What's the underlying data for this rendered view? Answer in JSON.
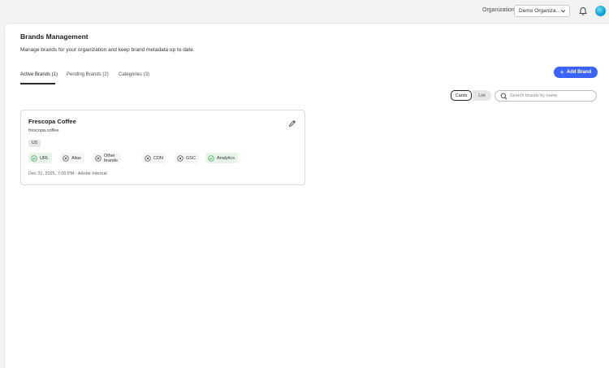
{
  "header": {
    "org_label": "Organization",
    "org_selected": "Demo Organiza...",
    "icons": {
      "bell": "bell-icon",
      "avatar": "user-avatar"
    }
  },
  "page": {
    "title": "Brands Management",
    "subtitle": "Manage brands for your organization and keep brand metadata up to date.",
    "add_button": "Add Brand"
  },
  "tabs": [
    {
      "label": "Active Brands (1)",
      "active": true
    },
    {
      "label": "Pending Brands (2)",
      "active": false
    },
    {
      "label": "Categories (3)",
      "active": false
    }
  ],
  "view_toggle": {
    "cards": "Cards",
    "list": "List",
    "selected": "Cards"
  },
  "search": {
    "placeholder": "Search brands by name",
    "value": ""
  },
  "brand_card": {
    "name": "Frescopa Coffee",
    "domain": "frescopa.coffee",
    "region": "US",
    "chips": [
      {
        "label": "URL",
        "status": "ok"
      },
      {
        "label": "Alias",
        "status": "missing"
      },
      {
        "label": "Other brands",
        "status": "missing"
      },
      {
        "label": "CDN",
        "status": "missing"
      },
      {
        "label": "GSC",
        "status": "missing"
      },
      {
        "label": "Analytics",
        "status": "ok"
      }
    ],
    "meta": "Dec 31, 2025, 7:00 PM · Adobe Internal"
  },
  "colors": {
    "accent": "#3b63fb",
    "ok_chip_bg": "#e8f4ea",
    "ok_icon": "#2d9d4f",
    "missing_icon": "#444444"
  }
}
